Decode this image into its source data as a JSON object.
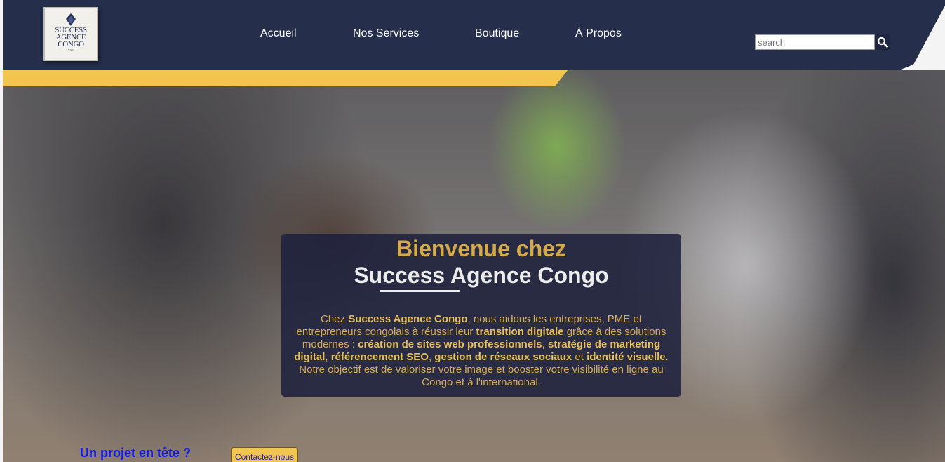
{
  "header": {
    "logo": {
      "line1": "SUCCESS",
      "line2": "AGENCE",
      "line3": "CONGO",
      "tagline": "S · A · C"
    },
    "nav": [
      {
        "label": "Accueil"
      },
      {
        "label": "Nos Services"
      },
      {
        "label": "Boutique"
      },
      {
        "label": "À Propos"
      }
    ],
    "search": {
      "placeholder": "search",
      "icon": "search-icon"
    }
  },
  "hero": {
    "title_line1": "Bienvenue chez",
    "title_line2": "Success Agence Congo",
    "paragraph": {
      "p1": "Chez ",
      "b1": "Success Agence Congo",
      "p2": ", nous aidons les entreprises, PME et entrepreneurs congolais à réussir leur ",
      "b2": "transition digitale",
      "p3": " grâce à des solutions modernes : ",
      "b3": "création de sites web professionnels",
      "p4": ", ",
      "b4": "stratégie de marketing digital",
      "p5": ", ",
      "b5": "référencement SEO",
      "p6": ", ",
      "b6": "gestion de réseaux sociaux",
      "p7": " et ",
      "b7": "identité visuelle",
      "p8": ". Notre objectif est de valoriser votre image et booster votre visibilité en ligne au Congo et à l'international."
    }
  },
  "cta": {
    "question": "Un projet en tête ?",
    "button_label": "Contactez-nous"
  },
  "colors": {
    "header_bg": "#252e4b",
    "accent_yellow": "#f2c54f",
    "gold_text": "#d6aa4a",
    "link_blue": "#1219e6"
  }
}
